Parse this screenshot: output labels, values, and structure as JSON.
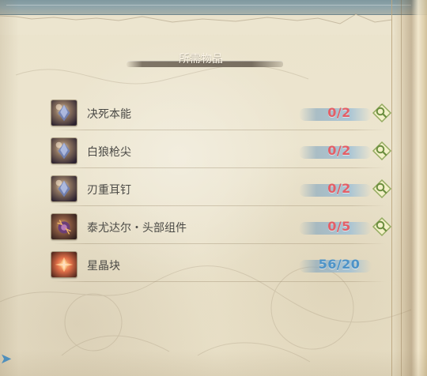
{
  "section": {
    "title": "所需物品"
  },
  "items": [
    {
      "name": "决死本能",
      "count": "0/2",
      "status": "short",
      "icon": "crystal-icon",
      "search_icon": "magnifier-icon"
    },
    {
      "name": "白狼枪尖",
      "count": "0/2",
      "status": "short",
      "icon": "crystal-icon",
      "search_icon": "magnifier-icon"
    },
    {
      "name": "刃重耳钉",
      "count": "0/2",
      "status": "short",
      "icon": "crystal-icon",
      "search_icon": "magnifier-icon"
    },
    {
      "name": "泰尤达尔・头部组件",
      "count": "0/5",
      "status": "short",
      "icon": "orb-icon",
      "search_icon": "magnifier-icon"
    },
    {
      "name": "星晶块",
      "count": "56/20",
      "status": "ok",
      "icon": "star-crystal-icon"
    }
  ],
  "colors": {
    "short": "#e35f67",
    "ok": "#4d93c8",
    "parchment": "#ece5cf",
    "header_bar": "#786e60"
  }
}
